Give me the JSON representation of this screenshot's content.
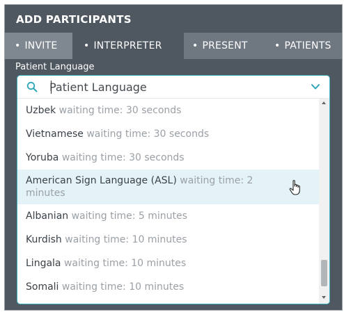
{
  "header": {
    "title": "ADD PARTICIPANTS"
  },
  "tabs": [
    {
      "label": "INVITE"
    },
    {
      "label": "INTERPRETER"
    },
    {
      "label": "PRESENT"
    },
    {
      "label": "PATIENTS"
    }
  ],
  "tab_bullet": "•",
  "field": {
    "label": "Patient Language",
    "placeholder": "Patient Language"
  },
  "languages": [
    {
      "name": "Uzbek",
      "wait": "waiting time: 30 seconds"
    },
    {
      "name": "Vietnamese",
      "wait": "waiting time: 30 seconds"
    },
    {
      "name": "Yoruba",
      "wait": "waiting time: 30 seconds"
    },
    {
      "name": "American Sign Language (ASL)",
      "wait": "waiting time: 2 minutes"
    },
    {
      "name": "Albanian",
      "wait": "waiting time: 5 minutes"
    },
    {
      "name": "Kurdish",
      "wait": "waiting time: 10 minutes"
    },
    {
      "name": "Lingala",
      "wait": "waiting time: 10 minutes"
    },
    {
      "name": "Somali",
      "wait": "waiting time: 10 minutes"
    }
  ],
  "colors": {
    "accent": "#3bb3c3",
    "highlight": "#e3f3f7",
    "header_bg": "#4f5860"
  },
  "icons": {
    "search": "search-icon",
    "chevron": "chevron-down-icon",
    "cursor": "hand-pointer-icon"
  }
}
